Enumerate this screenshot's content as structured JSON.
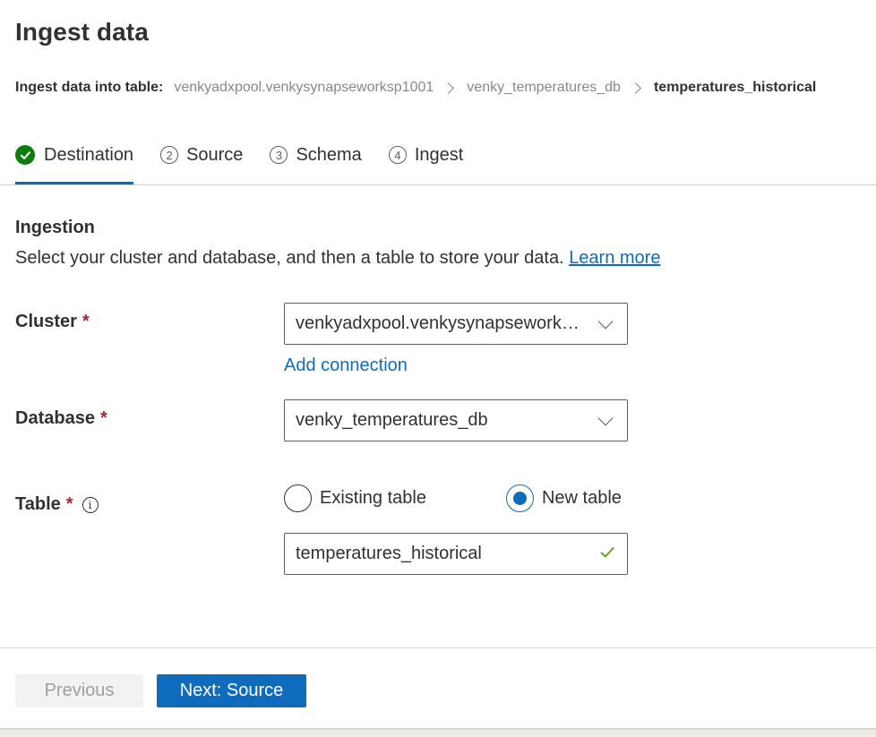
{
  "page": {
    "title": "Ingest data"
  },
  "breadcrumb": {
    "prefix": "Ingest data into table:",
    "items": [
      "venkyadxpool.venkysynapseworksp1001",
      "venky_temperatures_db"
    ],
    "current": "temperatures_historical"
  },
  "steps": [
    {
      "number": "",
      "label": "Destination",
      "state": "completed"
    },
    {
      "number": "2",
      "label": "Source",
      "state": "pending"
    },
    {
      "number": "3",
      "label": "Schema",
      "state": "pending"
    },
    {
      "number": "4",
      "label": "Ingest",
      "state": "pending"
    }
  ],
  "ingestion": {
    "title": "Ingestion",
    "description": "Select your cluster and database, and then a table to store your data.",
    "learn_more": "Learn more"
  },
  "fields": {
    "cluster": {
      "label": "Cluster",
      "required_mark": "*",
      "value": "venkyadxpool.venkysynapseworksp1001",
      "add_connection": "Add connection"
    },
    "database": {
      "label": "Database",
      "required_mark": "*",
      "value": "venky_temperatures_db"
    },
    "table": {
      "label": "Table",
      "required_mark": "*",
      "info_icon": "i",
      "options": [
        {
          "label": "Existing table",
          "selected": false
        },
        {
          "label": "New table",
          "selected": true
        }
      ],
      "value": "temperatures_historical"
    }
  },
  "footer": {
    "previous_label": "Previous",
    "next_label": "Next: Source"
  },
  "colors": {
    "accent": "#0f6cbd",
    "success": "#107c10",
    "valid_check": "#5ea71a",
    "required": "#a4262c"
  }
}
